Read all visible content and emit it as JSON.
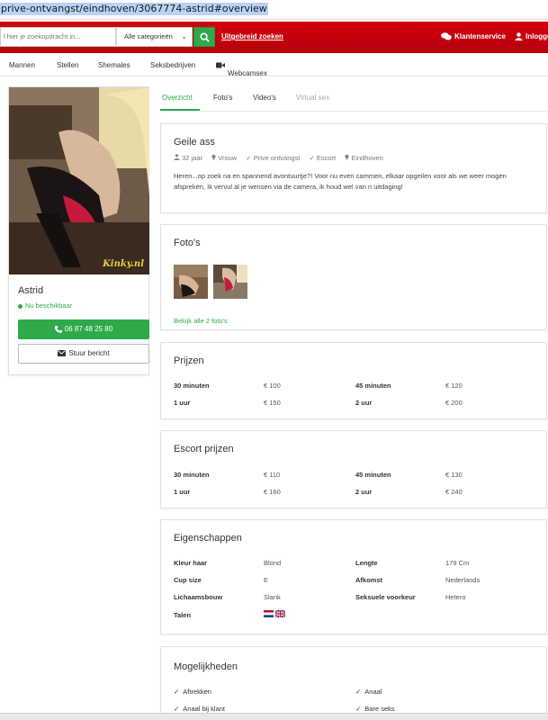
{
  "browser": {
    "url": "prive-ontvangst/eindhoven/3067774-astrid#overview"
  },
  "header": {
    "search_placeholder": "l hier je zoekopdracht in...",
    "category_select": "Alle categorieën",
    "advanced_search": "Uitgebreid zoeken",
    "customer_service": "Klantenservice",
    "login": "Inlogge",
    "brand_color": "#c4000b"
  },
  "nav": {
    "items": [
      "Mannen",
      "Stellen",
      "Shemales",
      "Seksbedrijven",
      "Webcamsex"
    ]
  },
  "profile": {
    "name": "Astrid",
    "status": "Nu beschikbaar",
    "phone": "06 87 48 25 80",
    "message_button": "Stuur bericht",
    "watermark": "Kinky.nl"
  },
  "tabs": [
    "Overzicht",
    "Foto's",
    "Video's",
    "Virtual sex"
  ],
  "overview": {
    "title": "Geile ass",
    "meta": [
      "32 jaar",
      "Vrouw",
      "Prive ontvangst",
      "Escort",
      "Eindhoven"
    ],
    "description": "Heren...op zoek na en spannend avontuurtje?! Voor nu even cammen, elkaar opgeilen voor als we weer mogen afspreken, Ik vervul al je wensen via de camera, ik houd wel van n uitdaging!"
  },
  "photos": {
    "title": "Foto's",
    "link": "Bekijk alle 2 foto's"
  },
  "prices": {
    "title": "Prijzen",
    "rows": [
      {
        "k1": "30 minuten",
        "v1": "€ 100",
        "k2": "45 minuten",
        "v2": "€ 120"
      },
      {
        "k1": "1 uur",
        "v1": "€ 150",
        "k2": "2 uur",
        "v2": "€ 200"
      }
    ]
  },
  "escort_prices": {
    "title": "Escort prijzen",
    "rows": [
      {
        "k1": "30 minuten",
        "v1": "€ 110",
        "k2": "45 minuten",
        "v2": "€ 130"
      },
      {
        "k1": "1 uur",
        "v1": "€ 160",
        "k2": "2 uur",
        "v2": "€ 240"
      }
    ]
  },
  "properties": {
    "title": "Eigenschappen",
    "rows": [
      {
        "k1": "Kleur haar",
        "v1": "Blond",
        "k2": "Lengte",
        "v2": "179 Cm"
      },
      {
        "k1": "Cup size",
        "v1": "E",
        "k2": "Afkomst",
        "v2": "Nederlands"
      },
      {
        "k1": "Lichaamsbouw",
        "v1": "Slank",
        "k2": "Seksuele voorkeur",
        "v2": "Hetero"
      }
    ],
    "languages_label": "Talen",
    "languages": [
      "nl-flag-icon",
      "uk-flag-icon"
    ]
  },
  "options": {
    "title": "Mogelijkheden",
    "items": [
      "Aftrekken",
      "Anaal",
      "Anaal bij klant",
      "Bare seks"
    ]
  }
}
